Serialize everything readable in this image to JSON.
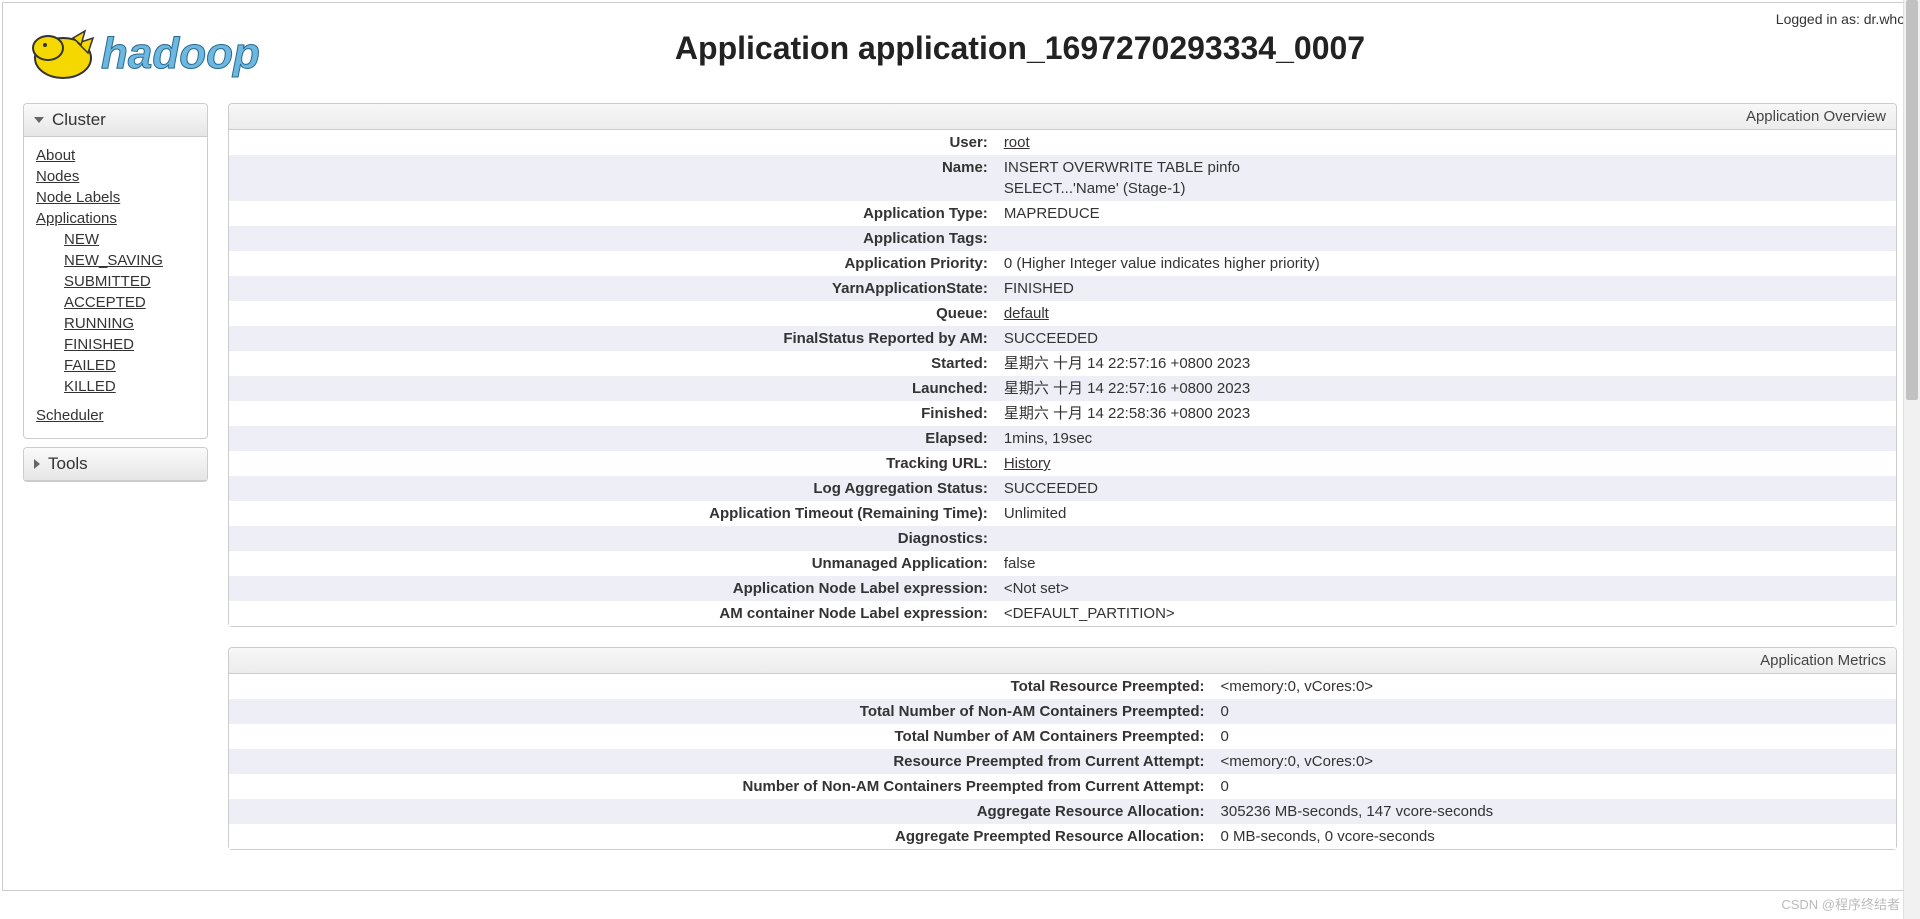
{
  "loggedInLabel": "Logged in as:",
  "loggedInUser": "dr.who",
  "pageTitle": "Application application_1697270293334_0007",
  "sidebar": {
    "clusterHeader": "Cluster",
    "toolsHeader": "Tools",
    "about": "About",
    "nodes": "Nodes",
    "nodeLabels": "Node Labels",
    "applications": "Applications",
    "states": {
      "new": "NEW",
      "newSaving": "NEW_SAVING",
      "submitted": "SUBMITTED",
      "accepted": "ACCEPTED",
      "running": "RUNNING",
      "finished": "FINISHED",
      "failed": "FAILED",
      "killed": "KILLED"
    },
    "scheduler": "Scheduler"
  },
  "overview": {
    "title": "Application Overview",
    "rows": {
      "user": {
        "label": "User:",
        "value": "root",
        "link": true
      },
      "name": {
        "label": "Name:",
        "value": "INSERT OVERWRITE TABLE pinfo\nSELECT...'Name' (Stage-1)"
      },
      "appType": {
        "label": "Application Type:",
        "value": "MAPREDUCE"
      },
      "appTags": {
        "label": "Application Tags:",
        "value": ""
      },
      "priority": {
        "label": "Application Priority:",
        "value": "0 (Higher Integer value indicates higher priority)"
      },
      "yarnState": {
        "label": "YarnApplicationState:",
        "value": "FINISHED"
      },
      "queue": {
        "label": "Queue:",
        "value": "default",
        "link": true
      },
      "finalStatus": {
        "label": "FinalStatus Reported by AM:",
        "value": "SUCCEEDED"
      },
      "started": {
        "label": "Started:",
        "value": "星期六 十月 14 22:57:16 +0800 2023"
      },
      "launched": {
        "label": "Launched:",
        "value": "星期六 十月 14 22:57:16 +0800 2023"
      },
      "finished": {
        "label": "Finished:",
        "value": "星期六 十月 14 22:58:36 +0800 2023"
      },
      "elapsed": {
        "label": "Elapsed:",
        "value": "1mins, 19sec"
      },
      "tracking": {
        "label": "Tracking URL:",
        "value": "History",
        "link": true
      },
      "logAgg": {
        "label": "Log Aggregation Status:",
        "value": "SUCCEEDED"
      },
      "timeout": {
        "label": "Application Timeout (Remaining Time):",
        "value": "Unlimited"
      },
      "diag": {
        "label": "Diagnostics:",
        "value": ""
      },
      "unmanaged": {
        "label": "Unmanaged Application:",
        "value": "false"
      },
      "appNodeLabel": {
        "label": "Application Node Label expression:",
        "value": "<Not set>"
      },
      "amNodeLabel": {
        "label": "AM container Node Label expression:",
        "value": "<DEFAULT_PARTITION>"
      }
    }
  },
  "metrics": {
    "title": "Application Metrics",
    "rows": {
      "totalPreempted": {
        "label": "Total Resource Preempted:",
        "value": "<memory:0, vCores:0>"
      },
      "nonAmPreempted": {
        "label": "Total Number of Non-AM Containers Preempted:",
        "value": "0"
      },
      "amPreempted": {
        "label": "Total Number of AM Containers Preempted:",
        "value": "0"
      },
      "currentPreempted": {
        "label": "Resource Preempted from Current Attempt:",
        "value": "<memory:0, vCores:0>"
      },
      "nonAmCurrent": {
        "label": "Number of Non-AM Containers Preempted from Current Attempt:",
        "value": "0"
      },
      "aggregate": {
        "label": "Aggregate Resource Allocation:",
        "value": "305236 MB-seconds, 147 vcore-seconds"
      },
      "aggPreempted": {
        "label": "Aggregate Preempted Resource Allocation:",
        "value": "0 MB-seconds, 0 vcore-seconds"
      }
    }
  },
  "watermark": "CSDN @程序终结者"
}
